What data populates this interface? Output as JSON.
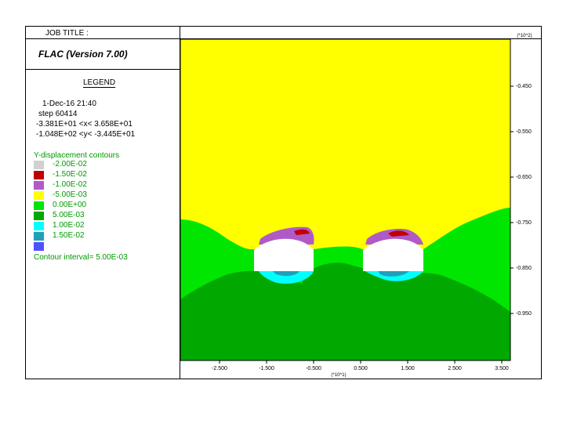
{
  "header": {
    "job_title": "JOB TITLE :",
    "app_title": "FLAC (Version 7.00)"
  },
  "legend": {
    "title": "LEGEND",
    "date_time": "1-Dec-16  21:40",
    "step": "step    60414",
    "x_range": "-3.381E+01 <x<  3.658E+01",
    "y_range": "-1.048E+02 <y< -3.445E+01",
    "contour_heading": "Y-displacement contours",
    "contour_interval": "Contour interval=  5.00E-03",
    "contours": [
      {
        "label": "-2.00E-02",
        "color": "#d0d0d0"
      },
      {
        "label": "-1.50E-02",
        "color": "#c00000"
      },
      {
        "label": "-1.00E-02",
        "color": "#b05ac8"
      },
      {
        "label": "-5.00E-03",
        "color": "#ffff00"
      },
      {
        "label": "0.00E+00",
        "color": "#00e600"
      },
      {
        "label": "5.00E-03",
        "color": "#00a800"
      },
      {
        "label": "1.00E-02",
        "color": "#00ffff"
      },
      {
        "label": "1.50E-02",
        "color": "#1fa0b8"
      },
      {
        "label": "",
        "color": "#5050ff"
      }
    ]
  },
  "axes": {
    "x_ticks": [
      "-2.500",
      "-1.500",
      "-0.500",
      "0.500",
      "1.500",
      "2.500",
      "3.500"
    ],
    "x_multiplier": "(*10^1)",
    "y_ticks": [
      "-0.450",
      "-0.550",
      "-0.650",
      "-0.750",
      "-0.850",
      "-0.950"
    ],
    "y_multiplier": "(*10^2)"
  },
  "colors": {
    "yellow": "#ffff00",
    "light_green": "#00e600",
    "dark_green": "#00a800",
    "purple": "#b05ac8",
    "red": "#c00000",
    "cyan": "#00ffff",
    "teal": "#1fa0b8",
    "opening": "#ffffff"
  }
}
